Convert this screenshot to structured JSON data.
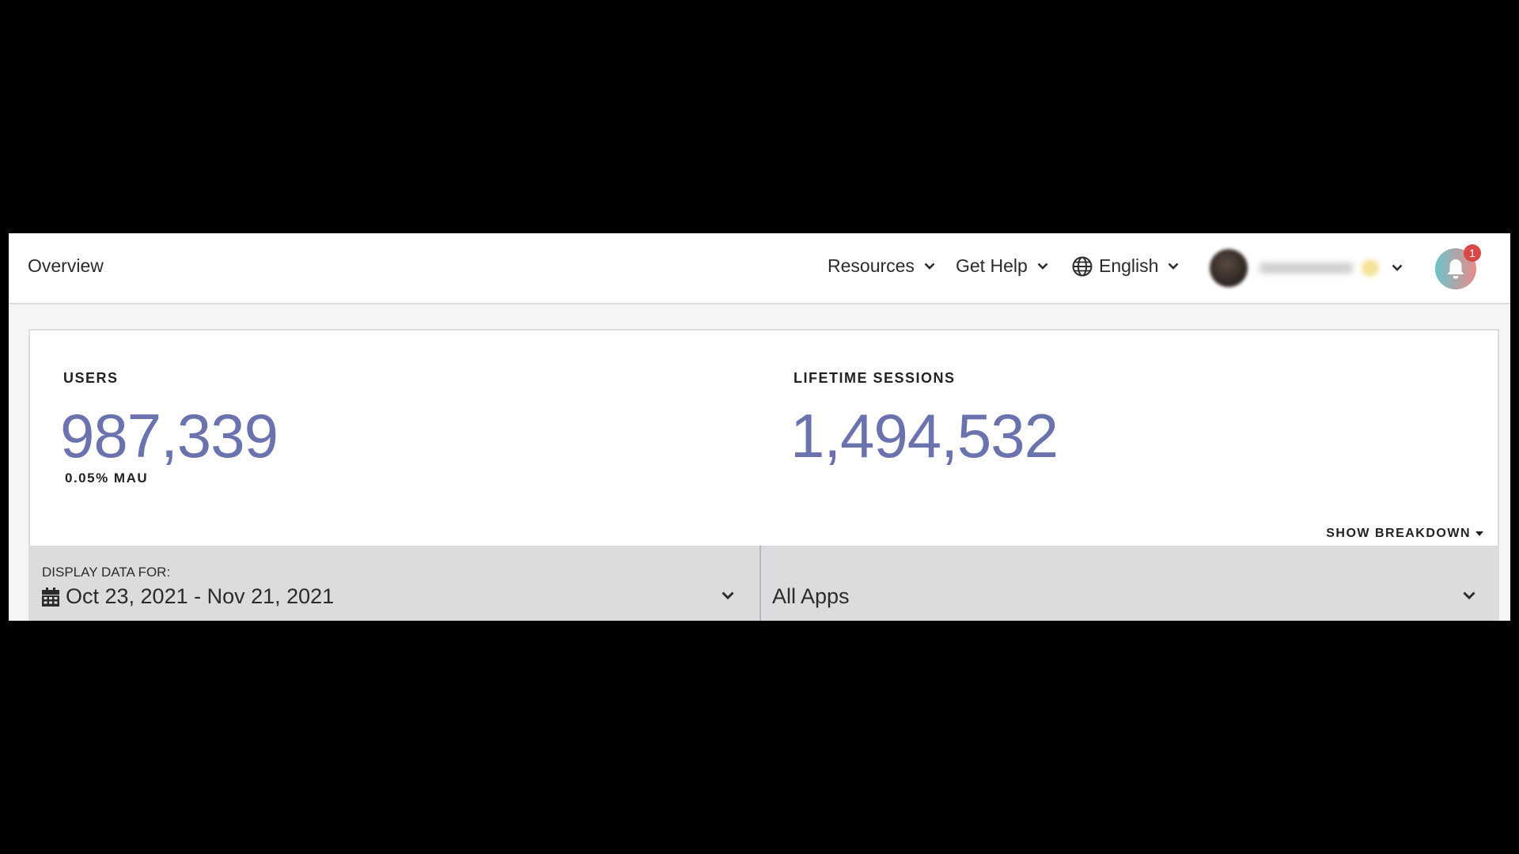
{
  "header": {
    "title": "Overview",
    "nav": {
      "resources": "Resources",
      "get_help": "Get Help",
      "language": "English"
    },
    "notifications": {
      "count": "1"
    }
  },
  "stats": {
    "users": {
      "label": "USERS",
      "value": "987,339",
      "sub": "0.05% MAU"
    },
    "sessions": {
      "label": "LIFETIME SESSIONS",
      "value": "1,494,532"
    },
    "breakdown_label": "SHOW BREAKDOWN"
  },
  "filters": {
    "date": {
      "caption": "DISPLAY DATA FOR:",
      "value": "Oct 23, 2021 - Nov 21, 2021"
    },
    "apps": {
      "value": "All Apps"
    }
  },
  "icons": {
    "globe": "globe-icon",
    "chevron": "chevron-down-icon",
    "bell": "bell-icon",
    "calendar": "calendar-icon",
    "caret": "caret-down-icon"
  },
  "colors": {
    "stat_value": "#6a73ad",
    "badge": "#d84a4a",
    "filter_bg": "#dcdcdf"
  }
}
